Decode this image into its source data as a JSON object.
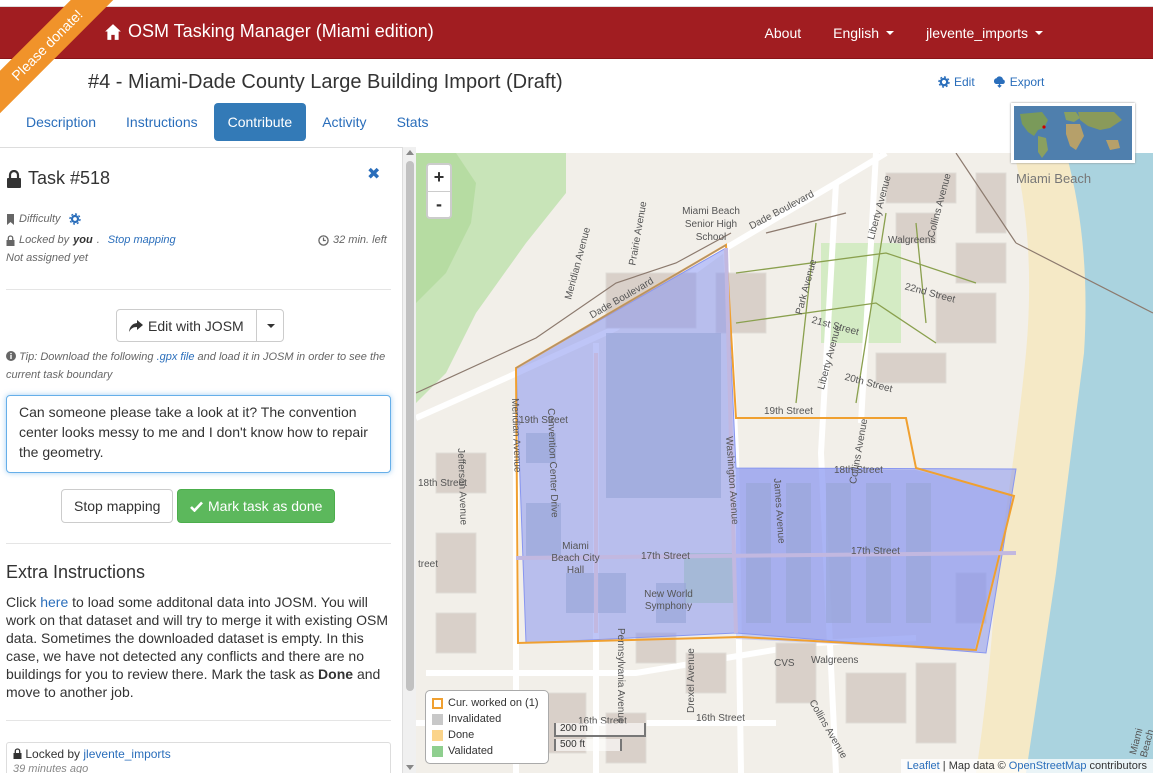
{
  "navbar": {
    "donate_ribbon": "Please donate!",
    "brand": "OSM Tasking Manager (Miami edition)",
    "links": {
      "about": "About",
      "language": "English",
      "user": "jlevente_imports"
    }
  },
  "project": {
    "title": "#4 - Miami-Dade County Large Building Import (Draft)",
    "edit_label": "Edit",
    "export_label": "Export",
    "minimap_label": "Miami Beach"
  },
  "tabs": [
    {
      "label": "Description"
    },
    {
      "label": "Instructions"
    },
    {
      "label": "Contribute",
      "active": true
    },
    {
      "label": "Activity"
    },
    {
      "label": "Stats"
    }
  ],
  "task": {
    "title": "Task #518",
    "difficulty_label": "Difficulty",
    "locked_prefix": "Locked by",
    "locked_by": "you",
    "stop_mapping_link": "Stop mapping",
    "time_left": "32 min. left",
    "assigned": "Not assigned yet",
    "edit_button": "Edit with JOSM",
    "tip_prefix": "Tip: Download the following",
    "tip_link": ".gpx file",
    "tip_suffix": "and load it in JOSM in order to see the current task boundary",
    "comment": "Can someone please take a look at it? The convention center looks messy to me and I don't know how to repair the geometry.",
    "stop_button": "Stop mapping",
    "done_button": "Mark task as done"
  },
  "extra": {
    "heading": "Extra Instructions",
    "p1": "Click",
    "link": "here",
    "p2": "to load some additonal data into JOSM. You will work on that dataset and will try to merge it with existing OSM data. Sometimes the downloaded dataset is empty. In this case, we have not detected any conflicts and there are no buildings for you to review there. Mark the task as",
    "bold": "Done",
    "p3": "and move to another job."
  },
  "history": {
    "locked_prefix": "Locked by",
    "user": "jlevente_imports",
    "when": "39 minutes ago"
  },
  "map": {
    "zoom_in": "+",
    "zoom_out": "-",
    "legend": [
      {
        "label": "Cur. worked on (1)",
        "color": "#ffffff",
        "border": "#f0a030"
      },
      {
        "label": "Invalidated",
        "color": "#c8c8c8",
        "border": "#c8c8c8"
      },
      {
        "label": "Done",
        "color": "#fbd48a",
        "border": "#fbd48a"
      },
      {
        "label": "Validated",
        "color": "#8fcf8f",
        "border": "#8fcf8f"
      }
    ],
    "scale_m": "200 m",
    "scale_ft": "500 ft",
    "attribution_leaflet": "Leaflet",
    "attribution_mid": "| Map data ©",
    "attribution_osm": "OpenStreetMap",
    "attribution_end": "contributors",
    "labels": {
      "miami_beach": "Miami Beach",
      "dade_blvd_1": "Dade Boulevard",
      "dade_blvd_2": "Dade Boulevard",
      "meridian": "Meridian Avenue",
      "prairie": "Prairie Avenue",
      "school": "Miami Beach Senior High School",
      "walgreens_1": "Walgreens",
      "walgreens_2": "Walgreens",
      "st22": "22nd Street",
      "st21": "21st Street",
      "st20": "20th Street",
      "st19_a": "19th Street",
      "st19_b": "19th Street",
      "st18_a": "18th Street",
      "st18_b": "18th Street",
      "st17_a": "17th Street",
      "st17_b": "17th Street",
      "st16_a": "16th Street",
      "st16_b": "16th Street",
      "street_cut": "treet",
      "convention": "Convention Center Drive",
      "washington": "Washington Avenue",
      "jefferson": "Jefferson Avenue",
      "meridian2": "Meridian Avenue",
      "city_hall": "Miami Beach City Hall",
      "new_world": "New World Symphony",
      "james": "James Avenue",
      "collins_1": "Collins Avenue",
      "collins_2": "Collins Avenue",
      "collins_3": "Collins Avenue",
      "park": "Park Avenue",
      "liberty_1": "Liberty Avenue",
      "liberty_2": "Liberty Avenue",
      "pennsylvania": "Pennsylvania Avenue",
      "drexel": "Drexel Avenue",
      "cvs": "CVS",
      "beach": "Miami Beach"
    }
  }
}
